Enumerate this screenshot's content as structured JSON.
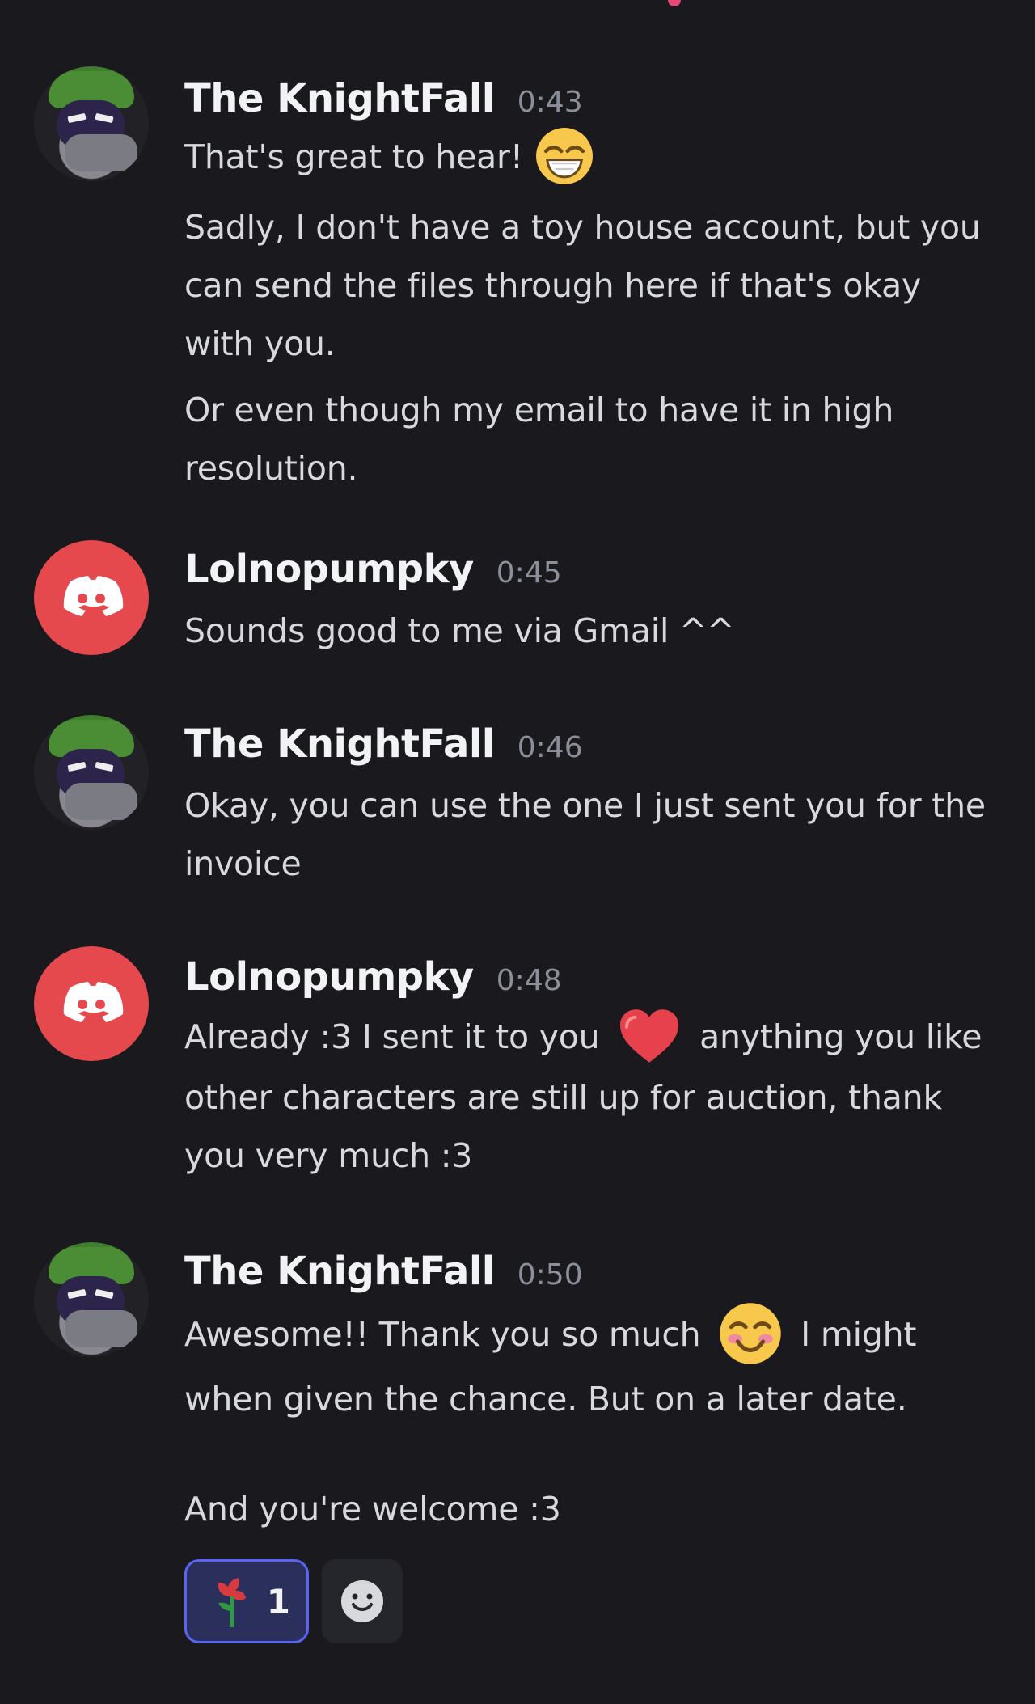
{
  "messages": [
    {
      "author": "The KnightFall",
      "time": "0:43",
      "line1": "That's great to hear!",
      "p2": "Sadly, I don't have a toy house account, but you can send the files through here if that's okay with you.",
      "p3": "Or even though my email to have it in high resolution."
    },
    {
      "author": "Lolnopumpky",
      "time": "0:45",
      "text": "Sounds good to me via Gmail ^^"
    },
    {
      "author": "The KnightFall",
      "time": "0:46",
      "text": "Okay, you can use the one I just sent you for the invoice"
    },
    {
      "author": "Lolnopumpky",
      "time": "0:48",
      "before_emoji": "Already :3 I sent it to you",
      "after_emoji": "anything you like other characters are still up for auction, thank you very much :3"
    },
    {
      "author": "The KnightFall",
      "time": "0:50",
      "before_emoji": "Awesome!! Thank you so much",
      "after_emoji": "I might when given the chance. But on a later date.",
      "closing": "And you're welcome :3"
    }
  ],
  "reactions": [
    {
      "emoji": "rose-emoji",
      "count": "1"
    },
    {
      "emoji": "add-reaction-icon"
    }
  ],
  "colors": {
    "background": "#1a1a1e",
    "username": "#f2f3f5",
    "timestamp": "#8b8f99",
    "body": "#d7d9dd",
    "discord_red": "#e5484d",
    "reaction_bg": "#2a2f5b",
    "reaction_border": "#5865f2",
    "top_indicator": "#e34a7a"
  }
}
